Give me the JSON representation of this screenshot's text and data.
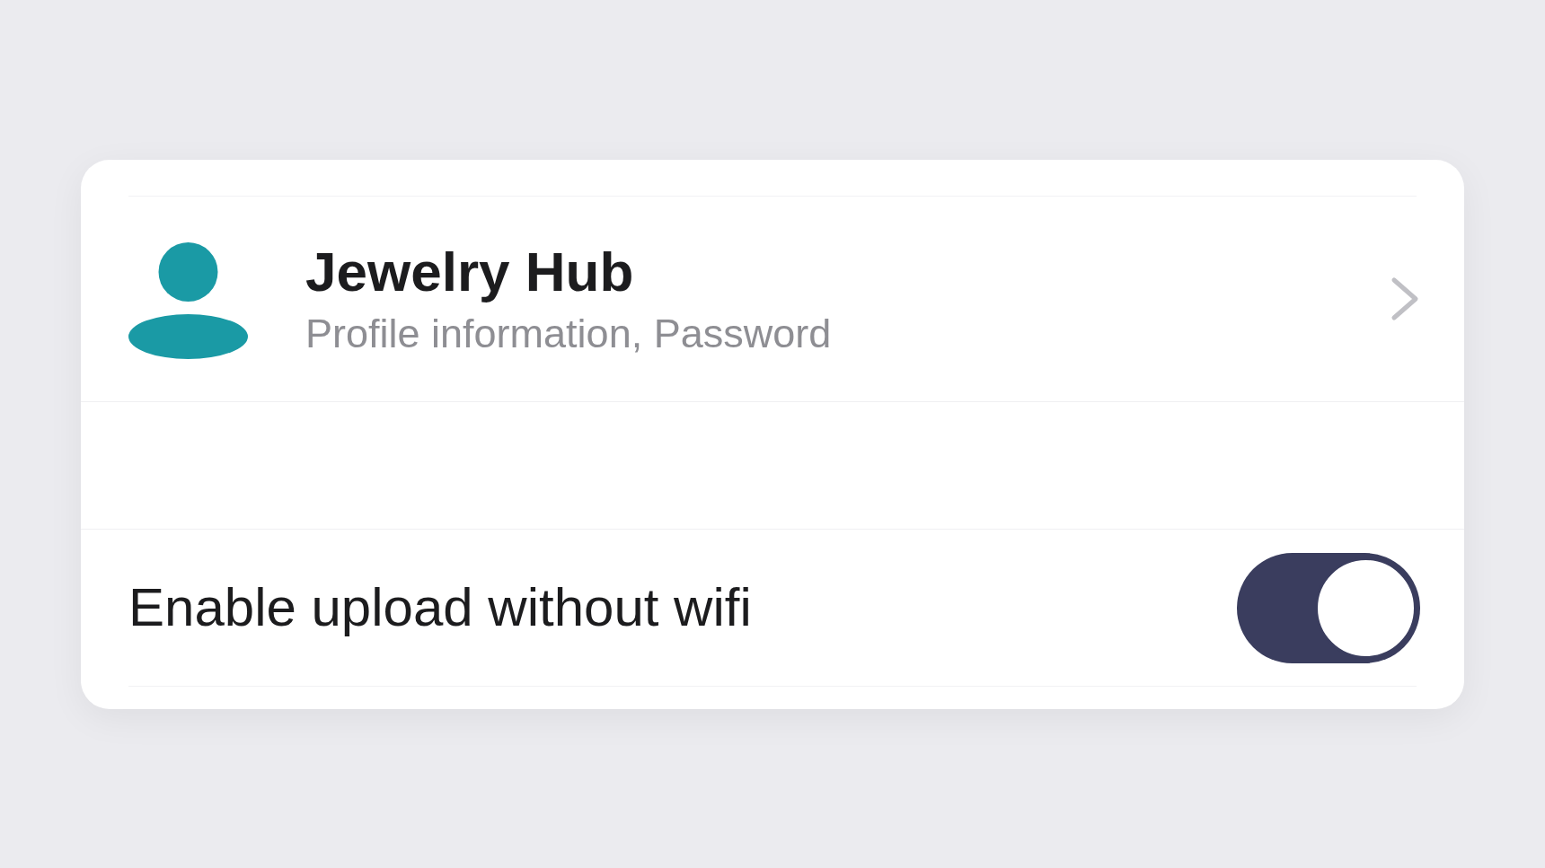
{
  "account": {
    "title": "Jewelry Hub",
    "subtitle": "Profile information, Password"
  },
  "settings": [
    {
      "kind": "toggle",
      "label": "Enable upload without wifi",
      "on": true
    }
  ]
}
